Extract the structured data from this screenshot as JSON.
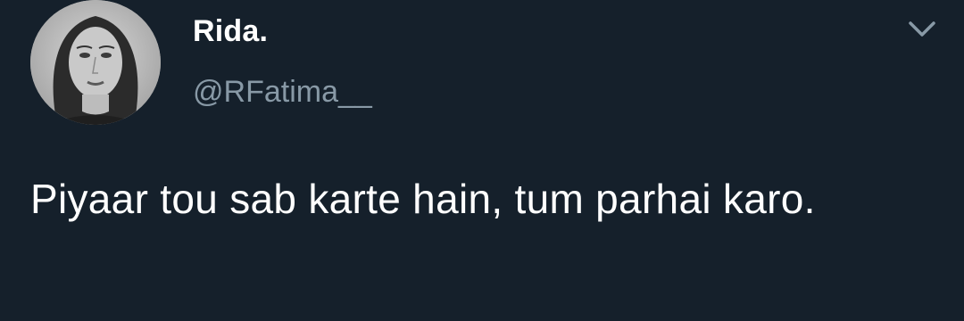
{
  "author": {
    "display_name": "Rida.",
    "handle": "@RFatima__",
    "avatar_icon": "profile-photo"
  },
  "tweet": {
    "text": "Piyaar tou sab karte hain, tum parhai karo."
  },
  "icons": {
    "menu": "chevron-down-icon"
  },
  "colors": {
    "background": "#15202b",
    "text_primary": "#ffffff",
    "text_secondary": "#8899a6"
  }
}
